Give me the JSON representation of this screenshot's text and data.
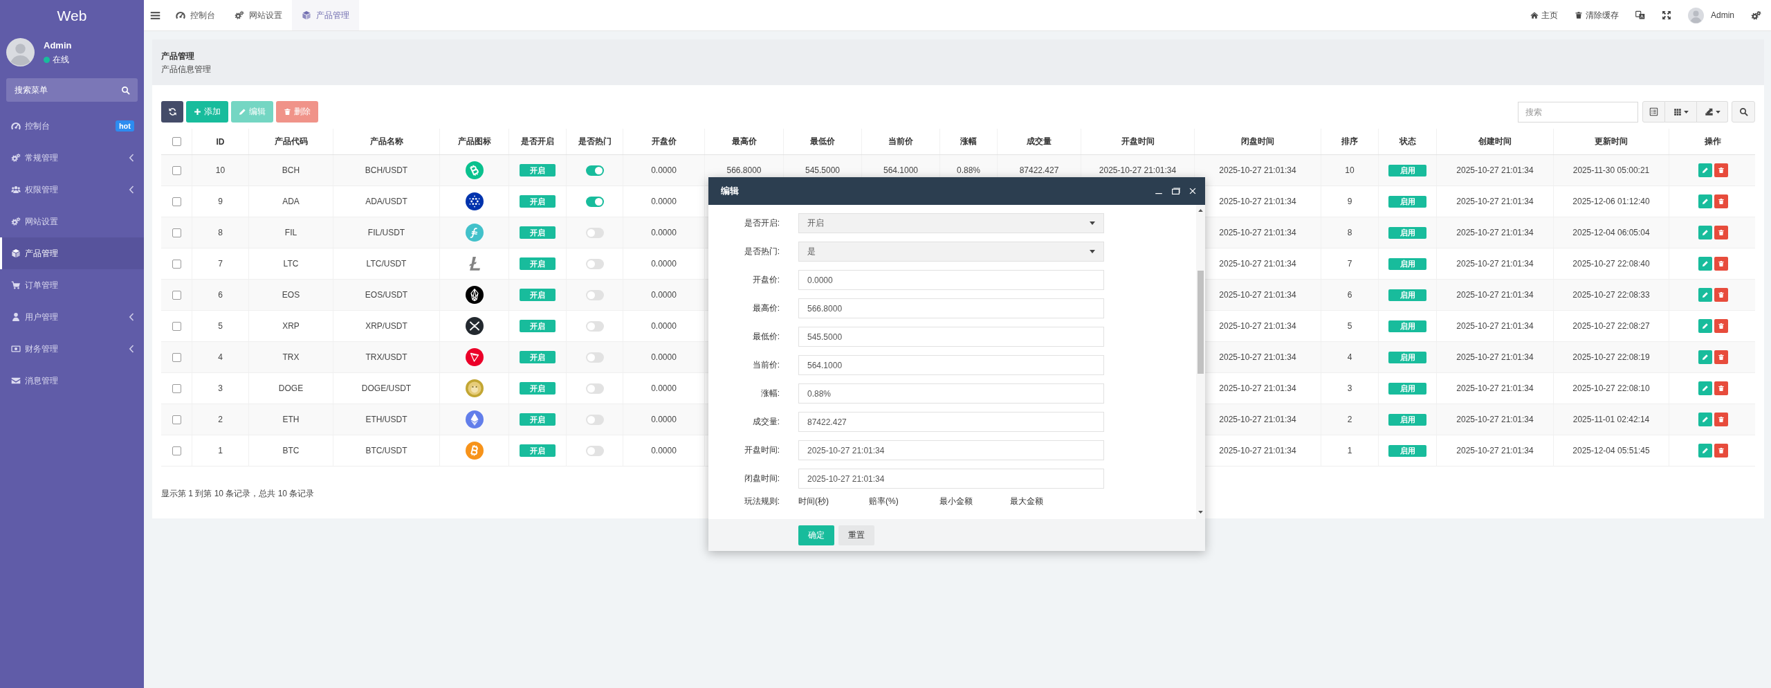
{
  "sidebar": {
    "logo": "Web",
    "user": {
      "name": "Admin",
      "status": "在线",
      "online": true
    },
    "search": {
      "placeholder": "搜索菜单"
    },
    "items": [
      {
        "kind": "link",
        "label": "控制台",
        "badge": "hot",
        "selected": false
      },
      {
        "kind": "group",
        "label": "常规管理",
        "expanded": false,
        "selected": false
      },
      {
        "kind": "group",
        "label": "权限管理",
        "expanded": false,
        "selected": false
      },
      {
        "kind": "link",
        "label": "网站设置",
        "selected": false
      },
      {
        "kind": "link",
        "label": "产品管理",
        "selected": true
      },
      {
        "kind": "link",
        "label": "订单管理",
        "selected": false
      },
      {
        "kind": "group",
        "label": "用户管理",
        "expanded": false,
        "selected": false
      },
      {
        "kind": "group",
        "label": "财务管理",
        "expanded": false,
        "selected": false
      },
      {
        "kind": "link",
        "label": "消息管理",
        "selected": false
      }
    ]
  },
  "topnav": {
    "tabs": [
      {
        "label": "控制台",
        "selected": false
      },
      {
        "label": "网站设置",
        "selected": false
      },
      {
        "label": "产品管理",
        "selected": true
      }
    ],
    "links": [
      {
        "label": "主页"
      },
      {
        "label": "清除缓存"
      }
    ],
    "user": "Admin"
  },
  "page_header": {
    "title": "产品管理",
    "subtitle": "产品信息管理"
  },
  "toolbar": {
    "buttons": [
      {
        "kind": "add",
        "label": "添加",
        "disabled": false
      },
      {
        "kind": "edit",
        "label": "编辑",
        "disabled": true
      },
      {
        "kind": "delete",
        "label": "删除",
        "disabled": true
      }
    ],
    "search": {
      "placeholder": "搜索"
    }
  },
  "table": {
    "all_checked": false,
    "columns": [
      "ID",
      "产品代码",
      "产品名称",
      "产品图标",
      "是否开启",
      "是否热门",
      "开盘价",
      "最高价",
      "最低价",
      "当前价",
      "涨幅",
      "成交量",
      "开盘时间",
      "闭盘时间",
      "排序",
      "状态",
      "创建时间",
      "更新时间",
      "操作"
    ],
    "rows": [
      {
        "selected": false,
        "id": "10",
        "code": "BCH",
        "name": "BCH/USDT",
        "open_flag": "开启",
        "hot": true,
        "open_price": "0.0000",
        "high": "566.8000",
        "low": "545.5000",
        "current": "564.1000",
        "change": "0.88%",
        "volume": "87422.427",
        "open_time": "2025-10-27 21:01:34",
        "close_time": "2025-10-27 21:01:34",
        "sort": "10",
        "status": "启用",
        "created": "2025-10-27 21:01:34",
        "updated": "2025-11-30 05:00:21"
      },
      {
        "selected": false,
        "id": "9",
        "code": "ADA",
        "name": "ADA/USDT",
        "open_flag": "开启",
        "hot": true,
        "open_price": "0.0000",
        "close_time": "2025-10-27 21:01:34",
        "sort": "9",
        "status": "启用",
        "created": "2025-10-27 21:01:34",
        "updated": "2025-12-06 01:12:40"
      },
      {
        "selected": false,
        "id": "8",
        "code": "FIL",
        "name": "FIL/USDT",
        "open_flag": "开启",
        "hot": false,
        "open_price": "0.0000",
        "close_time": "2025-10-27 21:01:34",
        "sort": "8",
        "status": "启用",
        "created": "2025-10-27 21:01:34",
        "updated": "2025-12-04 06:05:04"
      },
      {
        "selected": false,
        "id": "7",
        "code": "LTC",
        "name": "LTC/USDT",
        "open_flag": "开启",
        "hot": false,
        "open_price": "0.0000",
        "close_time": "2025-10-27 21:01:34",
        "sort": "7",
        "status": "启用",
        "created": "2025-10-27 21:01:34",
        "updated": "2025-10-27 22:08:40"
      },
      {
        "selected": false,
        "id": "6",
        "code": "EOS",
        "name": "EOS/USDT",
        "open_flag": "开启",
        "hot": false,
        "open_price": "0.0000",
        "close_time": "2025-10-27 21:01:34",
        "sort": "6",
        "status": "启用",
        "created": "2025-10-27 21:01:34",
        "updated": "2025-10-27 22:08:33"
      },
      {
        "selected": false,
        "id": "5",
        "code": "XRP",
        "name": "XRP/USDT",
        "open_flag": "开启",
        "hot": false,
        "open_price": "0.0000",
        "close_time": "2025-10-27 21:01:34",
        "sort": "5",
        "status": "启用",
        "created": "2025-10-27 21:01:34",
        "updated": "2025-10-27 22:08:27"
      },
      {
        "selected": false,
        "id": "4",
        "code": "TRX",
        "name": "TRX/USDT",
        "open_flag": "开启",
        "hot": false,
        "open_price": "0.0000",
        "close_time": "2025-10-27 21:01:34",
        "sort": "4",
        "status": "启用",
        "created": "2025-10-27 21:01:34",
        "updated": "2025-10-27 22:08:19"
      },
      {
        "selected": false,
        "id": "3",
        "code": "DOGE",
        "name": "DOGE/USDT",
        "open_flag": "开启",
        "hot": false,
        "open_price": "0.0000",
        "close_time": "2025-10-27 21:01:34",
        "sort": "3",
        "status": "启用",
        "created": "2025-10-27 21:01:34",
        "updated": "2025-10-27 22:08:10"
      },
      {
        "selected": false,
        "id": "2",
        "code": "ETH",
        "name": "ETH/USDT",
        "open_flag": "开启",
        "hot": false,
        "open_price": "0.0000",
        "close_time": "2025-10-27 21:01:34",
        "sort": "2",
        "status": "启用",
        "created": "2025-10-27 21:01:34",
        "updated": "2025-11-01 02:42:14"
      },
      {
        "selected": false,
        "id": "1",
        "code": "BTC",
        "name": "BTC/USDT",
        "open_flag": "开启",
        "hot": false,
        "open_price": "0.0000",
        "close_time": "2025-10-27 21:01:34",
        "sort": "1",
        "status": "启用",
        "created": "2025-10-27 21:01:34",
        "updated": "2025-12-04 05:51:45"
      }
    ],
    "summary": "显示第 1 到第 10 条记录，总共 10 条记录"
  },
  "dialog": {
    "title": "编辑",
    "fields": [
      {
        "kind": "select",
        "label": "是否开启:",
        "value": "开启"
      },
      {
        "kind": "select",
        "label": "是否热门:",
        "value": "是"
      },
      {
        "kind": "input",
        "label": "开盘价:",
        "value": "0.0000"
      },
      {
        "kind": "input",
        "label": "最高价:",
        "value": "566.8000"
      },
      {
        "kind": "input",
        "label": "最低价:",
        "value": "545.5000"
      },
      {
        "kind": "input",
        "label": "当前价:",
        "value": "564.1000"
      },
      {
        "kind": "input",
        "label": "涨幅:",
        "value": "0.88%"
      },
      {
        "kind": "input",
        "label": "成交量:",
        "value": "87422.427"
      },
      {
        "kind": "input",
        "label": "开盘时间:",
        "value": "2025-10-27 21:01:34"
      },
      {
        "kind": "input",
        "label": "闭盘时间:",
        "value": "2025-10-27 21:01:34"
      }
    ],
    "rules": {
      "label": "玩法规则:",
      "columns": [
        "时间(秒)",
        "赔率(%)",
        "最小金额",
        "最大金额"
      ]
    },
    "buttons": [
      {
        "kind": "submit",
        "label": "确定"
      },
      {
        "kind": "reset",
        "label": "重置"
      }
    ]
  }
}
